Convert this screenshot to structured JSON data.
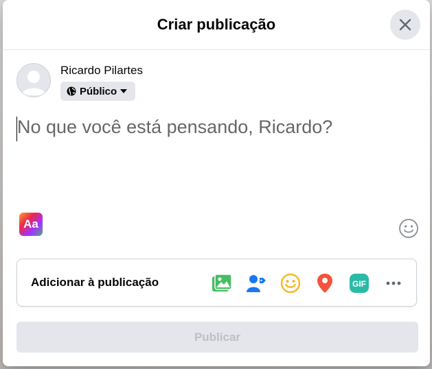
{
  "dialog": {
    "title": "Criar publicação"
  },
  "user": {
    "name": "Ricardo Pilartes",
    "audience": "Público"
  },
  "composer": {
    "placeholder": "No que você está pensando, Ricardo?"
  },
  "format_button": {
    "label": "Aa"
  },
  "add_to_post": {
    "label": "Adicionar à publicação",
    "icons": [
      "photo-video-icon",
      "tag-people-icon",
      "feeling-activity-icon",
      "check-in-icon",
      "gif-icon",
      "more-icon"
    ]
  },
  "publish_button": {
    "label": "Publicar"
  },
  "colors": {
    "photo": "#45bd62",
    "tag": "#1877f2",
    "feeling": "#f7b928",
    "checkin": "#f5533d",
    "gif": "#2abba7",
    "text": "#050505",
    "muted": "#65676b"
  }
}
